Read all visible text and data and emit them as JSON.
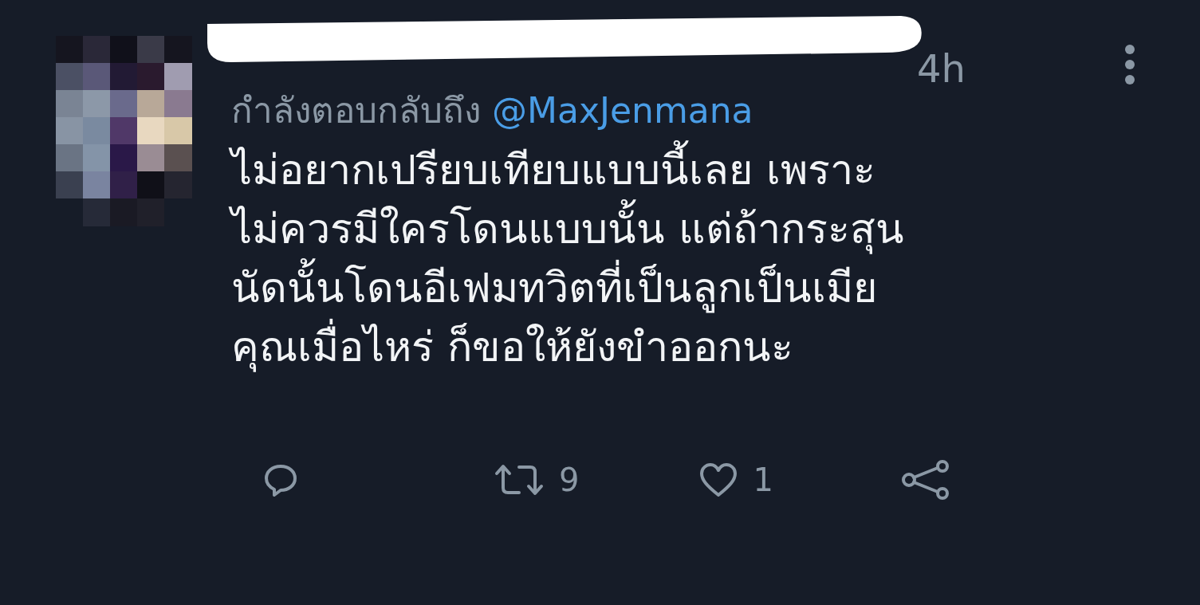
{
  "tweet": {
    "time": "4h",
    "reply_to": {
      "prefix": "กำลังตอบกลับถึง",
      "mention": "@MaxJenmana"
    },
    "lines": [
      "ไม่อยากเปรียบเทียบแบบนี้เลย เพราะ",
      "ไม่ควรมีใครโดนแบบนั้น แต่ถ้ากระสุน",
      "นัดนั้นโดนอีเฟมทวิตที่เป็นลูกเป็นเมีย",
      "คุณเมื่อไหร่ ก็ขอให้ยังขำออกนะ"
    ],
    "actions": [
      {
        "kind": "reply"
      },
      {
        "kind": "retweet",
        "count": "9"
      },
      {
        "kind": "like",
        "count": "1"
      },
      {
        "kind": "share"
      }
    ]
  }
}
